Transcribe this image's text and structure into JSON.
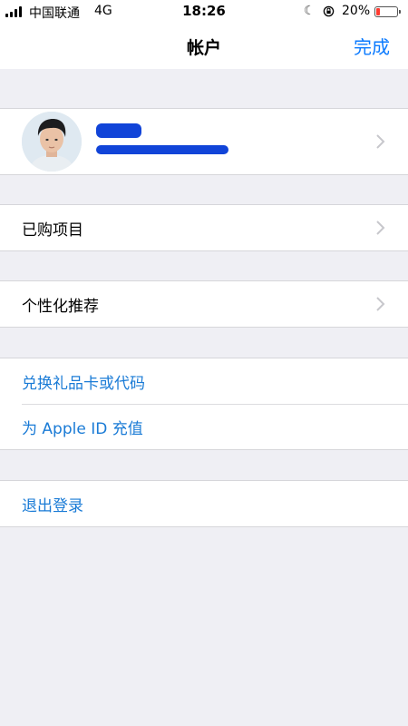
{
  "status_bar": {
    "carrier": "中国联通",
    "network": "4G",
    "time": "18:26",
    "battery_percent": "20%",
    "icons": [
      "signal-icon",
      "moon-icon",
      "rotation-lock-icon",
      "battery-icon"
    ],
    "battery_color": "#ff3b30"
  },
  "nav": {
    "title": "帐户",
    "done_label": "完成",
    "accent_color": "#0a7aff"
  },
  "profile": {
    "name_redacted": true,
    "email_redacted": true
  },
  "rows": {
    "purchased": "已购项目",
    "personalized": "个性化推荐",
    "redeem": "兑换礼品卡或代码",
    "add_funds": "为 Apple ID 充值",
    "sign_out": "退出登录"
  }
}
